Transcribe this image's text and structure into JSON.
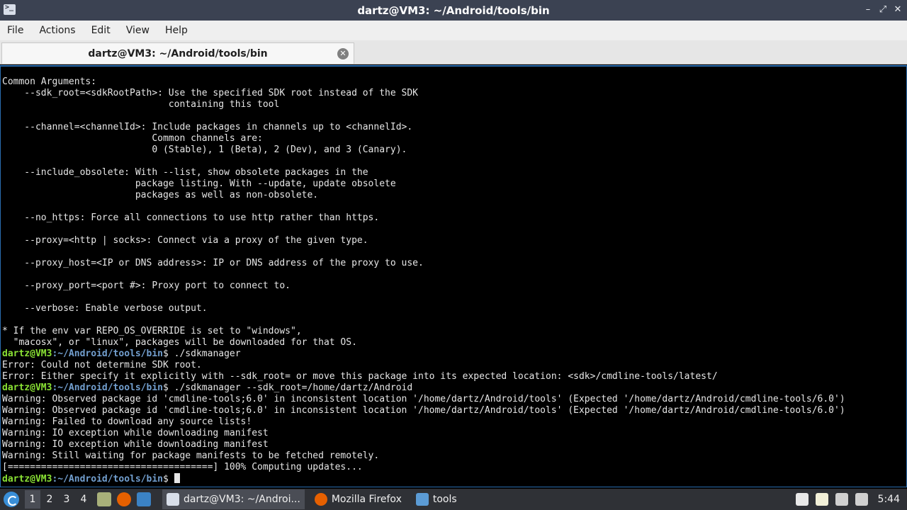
{
  "window": {
    "title": "dartz@VM3: ~/Android/tools/bin",
    "minimize_glyph": "–",
    "maximize_glyph": "⤢",
    "close_glyph": "✕"
  },
  "menu": {
    "file": "File",
    "actions": "Actions",
    "edit": "Edit",
    "view": "View",
    "help": "Help"
  },
  "tab": {
    "title": "dartz@VM3: ~/Android/tools/bin",
    "close_glyph": "✕"
  },
  "prompt": {
    "user_host": "dartz@VM3",
    "path": ":~/Android/tools/bin",
    "symbol": "$"
  },
  "terminal": {
    "lines": [
      {
        "type": "text",
        "text": "Common Arguments:"
      },
      {
        "type": "text",
        "text": "    --sdk_root=<sdkRootPath>: Use the specified SDK root instead of the SDK"
      },
      {
        "type": "text",
        "text": "                              containing this tool"
      },
      {
        "type": "text",
        "text": ""
      },
      {
        "type": "text",
        "text": "    --channel=<channelId>: Include packages in channels up to <channelId>."
      },
      {
        "type": "text",
        "text": "                           Common channels are:"
      },
      {
        "type": "text",
        "text": "                           0 (Stable), 1 (Beta), 2 (Dev), and 3 (Canary)."
      },
      {
        "type": "text",
        "text": ""
      },
      {
        "type": "text",
        "text": "    --include_obsolete: With --list, show obsolete packages in the"
      },
      {
        "type": "text",
        "text": "                        package listing. With --update, update obsolete"
      },
      {
        "type": "text",
        "text": "                        packages as well as non-obsolete."
      },
      {
        "type": "text",
        "text": ""
      },
      {
        "type": "text",
        "text": "    --no_https: Force all connections to use http rather than https."
      },
      {
        "type": "text",
        "text": ""
      },
      {
        "type": "text",
        "text": "    --proxy=<http | socks>: Connect via a proxy of the given type."
      },
      {
        "type": "text",
        "text": ""
      },
      {
        "type": "text",
        "text": "    --proxy_host=<IP or DNS address>: IP or DNS address of the proxy to use."
      },
      {
        "type": "text",
        "text": ""
      },
      {
        "type": "text",
        "text": "    --proxy_port=<port #>: Proxy port to connect to."
      },
      {
        "type": "text",
        "text": ""
      },
      {
        "type": "text",
        "text": "    --verbose: Enable verbose output."
      },
      {
        "type": "text",
        "text": ""
      },
      {
        "type": "text",
        "text": "* If the env var REPO_OS_OVERRIDE is set to \"windows\","
      },
      {
        "type": "text",
        "text": "  \"macosx\", or \"linux\", packages will be downloaded for that OS."
      },
      {
        "type": "prompt",
        "text": " ./sdkmanager"
      },
      {
        "type": "text",
        "text": "Error: Could not determine SDK root."
      },
      {
        "type": "text",
        "text": "Error: Either specify it explicitly with --sdk_root= or move this package into its expected location: <sdk>/cmdline-tools/latest/"
      },
      {
        "type": "prompt",
        "text": " ./sdkmanager --sdk_root=/home/dartz/Android"
      },
      {
        "type": "text",
        "text": "Warning: Observed package id 'cmdline-tools;6.0' in inconsistent location '/home/dartz/Android/tools' (Expected '/home/dartz/Android/cmdline-tools/6.0')"
      },
      {
        "type": "text",
        "text": "Warning: Observed package id 'cmdline-tools;6.0' in inconsistent location '/home/dartz/Android/tools' (Expected '/home/dartz/Android/cmdline-tools/6.0')"
      },
      {
        "type": "text",
        "text": "Warning: Failed to download any source lists!"
      },
      {
        "type": "text",
        "text": "Warning: IO exception while downloading manifest"
      },
      {
        "type": "text",
        "text": "Warning: IO exception while downloading manifest"
      },
      {
        "type": "text",
        "text": "Warning: Still waiting for package manifests to be fetched remotely."
      },
      {
        "type": "text",
        "text": "[=====================================] 100% Computing updates..."
      },
      {
        "type": "prompt",
        "text": " ",
        "cursor": true
      }
    ]
  },
  "taskbar": {
    "workspaces": [
      "1",
      "2",
      "3",
      "4"
    ],
    "active_workspace": "1",
    "quick_launch": [
      {
        "name": "files-icon",
        "color": "#a8b07a"
      },
      {
        "name": "firefox-icon",
        "color": "#e66000"
      },
      {
        "name": "desktop-icon",
        "color": "#3b82c4"
      }
    ],
    "tasks": [
      {
        "label": "dartz@VM3: ~/Androi...",
        "icon": "terminal-icon",
        "color": "#d8dee9",
        "active": true
      },
      {
        "label": "Mozilla Firefox",
        "icon": "firefox-icon",
        "color": "#e66000",
        "active": false
      },
      {
        "label": "tools",
        "icon": "folder-icon",
        "color": "#5b9bd5",
        "active": false
      }
    ],
    "tray": [
      {
        "name": "volume-icon",
        "color": "#e8e8e8"
      },
      {
        "name": "clipboard-icon",
        "color": "#f2f0d8"
      },
      {
        "name": "display-icon",
        "color": "#d0d0d0"
      },
      {
        "name": "network-icon",
        "color": "#d0d0d0"
      }
    ],
    "clock": "5:44"
  }
}
